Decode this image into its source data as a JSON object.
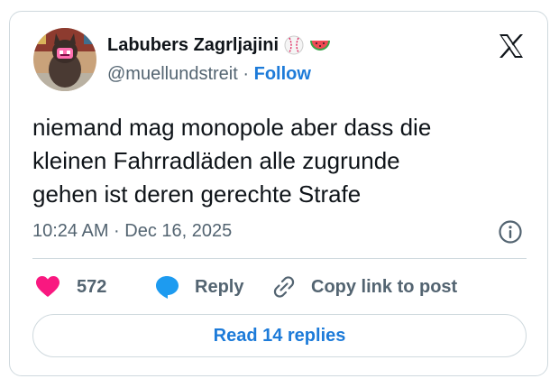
{
  "author": {
    "display_name": "Labubers Zagrljajini",
    "handle": "@muellundstreit",
    "separator": "·",
    "follow_label": "Follow",
    "badges": [
      "baseball-emoji",
      "watermelon-emoji"
    ]
  },
  "tweet": {
    "text": "niemand mag monopole aber dass die\nkleinen Fahrradläden alle zugrunde\ngehen ist deren gerechte Strafe",
    "timestamp": "10:24 AM · Dec 16, 2025"
  },
  "actions": {
    "like_count": "572",
    "reply_label": "Reply",
    "copy_link_label": "Copy link to post"
  },
  "footer": {
    "read_replies_label": "Read 14 replies"
  },
  "colors": {
    "accent": "#1d7bd9",
    "like": "#f91880",
    "secondary_text": "#536471",
    "border": "#cfd9de"
  },
  "icons": {
    "brand": "x-logo-icon",
    "info": "info-icon",
    "like": "heart-icon",
    "reply": "speech-bubble-icon",
    "copy": "link-icon"
  }
}
